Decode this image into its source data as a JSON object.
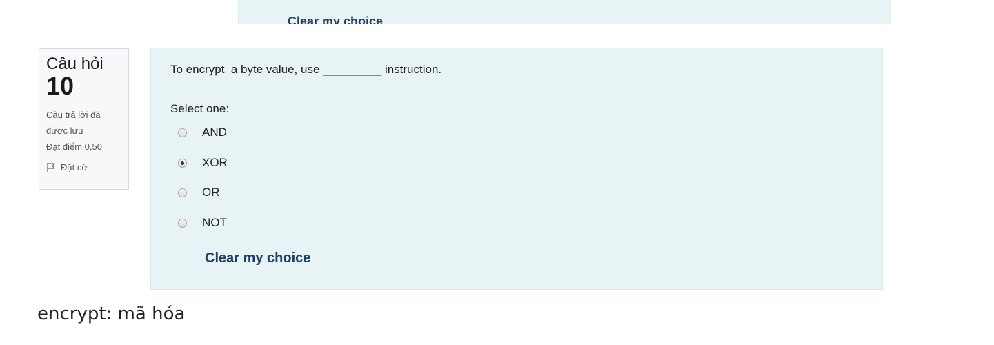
{
  "previous_question": {
    "clear_label": "Clear my choice"
  },
  "question_info": {
    "label": "Câu hỏi",
    "number": "10",
    "status": "Câu trả lời đã được lưu",
    "mark": "Đạt điểm 0,50",
    "flag_label": "Đặt cờ",
    "flag_icon": "flag-icon"
  },
  "question": {
    "text": "To encrypt  a byte value, use _________ instruction.",
    "select_prompt": "Select one:",
    "options": [
      {
        "label": "AND",
        "selected": false
      },
      {
        "label": "XOR",
        "selected": true
      },
      {
        "label": "OR",
        "selected": false
      },
      {
        "label": "NOT",
        "selected": false
      }
    ],
    "clear_label": "Clear my choice"
  },
  "note": "encrypt: mã hóa",
  "colors": {
    "question_bg": "#e7f3f5",
    "link": "#1f3f66",
    "card_bg": "#f7f8fa"
  }
}
